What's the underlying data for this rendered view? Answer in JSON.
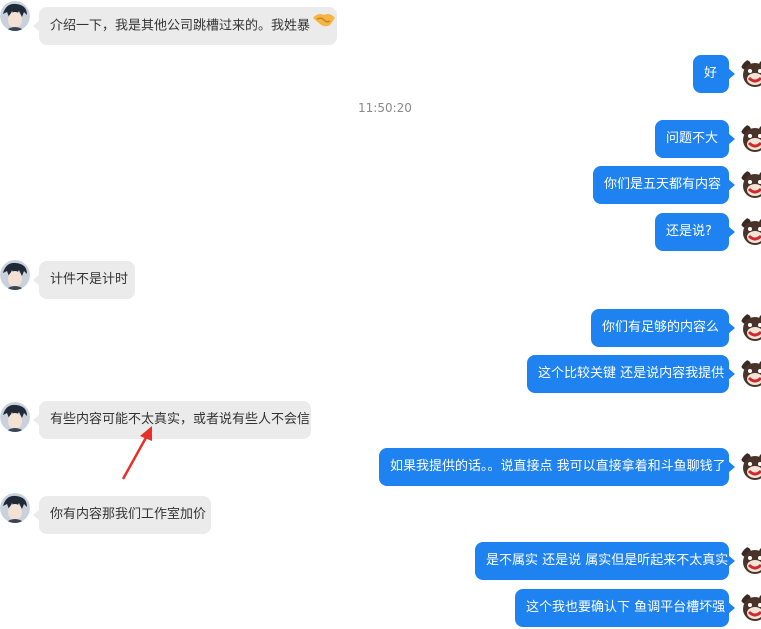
{
  "timestamp": "11:50:20",
  "messages": [
    {
      "side": "in",
      "text": "介绍一下，我是其他公司跳槽过来的。我姓暴",
      "emoji": "handshake-emoji"
    },
    {
      "side": "out",
      "text": "好"
    },
    {
      "side": "out",
      "text": "问题不大"
    },
    {
      "side": "out",
      "text": "你们是五天都有内容"
    },
    {
      "side": "out",
      "text": "还是说?"
    },
    {
      "side": "in",
      "text": "计件不是计时"
    },
    {
      "side": "out",
      "text": "你们有足够的内容么"
    },
    {
      "side": "out",
      "text": "这个比较关键 还是说内容我提供"
    },
    {
      "side": "in",
      "text": "有些内容可能不太真实，或者说有些人不会信"
    },
    {
      "side": "out",
      "text": "如果我提供的话。。说直接点 我可以直接拿着和斗鱼聊钱了"
    },
    {
      "side": "in",
      "text": "你有内容那我们工作室加价"
    },
    {
      "side": "out",
      "text": "是不属实 还是说 属实但是听起来不太真实"
    },
    {
      "side": "out",
      "text": "这个我也要确认下 鱼调平台槽坏强"
    }
  ],
  "colors": {
    "outgoing_bubble": "#1e82f0",
    "incoming_bubble": "#ebebeb",
    "annotation_arrow": "#e8302a"
  },
  "icons": {
    "incoming_avatar": "anime-boy-avatar",
    "outgoing_avatar": "bear-avatar",
    "annotation": "red-arrow"
  }
}
